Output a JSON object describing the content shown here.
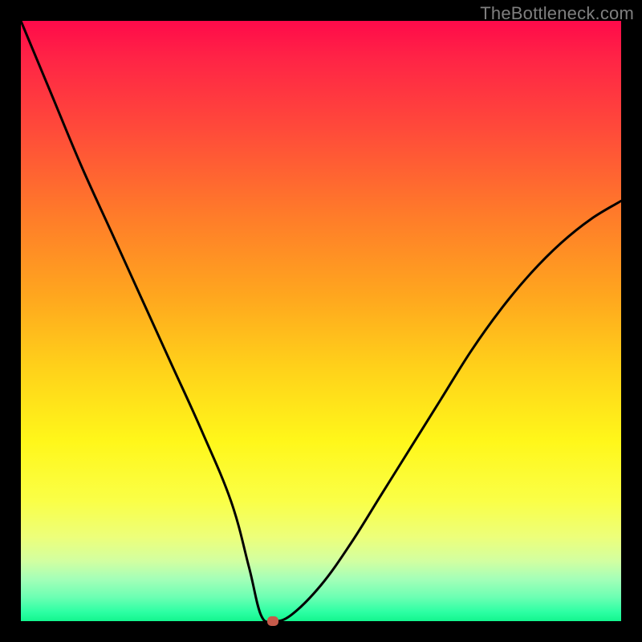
{
  "watermark": "TheBottleneck.com",
  "chart_data": {
    "type": "line",
    "title": "",
    "xlabel": "",
    "ylabel": "",
    "xlim": [
      0,
      100
    ],
    "ylim": [
      0,
      100
    ],
    "grid": false,
    "legend": false,
    "series": [
      {
        "name": "bottleneck-curve",
        "x": [
          0,
          5,
          10,
          15,
          20,
          25,
          30,
          35,
          38,
          40,
          42,
          45,
          50,
          55,
          60,
          65,
          70,
          75,
          80,
          85,
          90,
          95,
          100
        ],
        "y": [
          100,
          88,
          76,
          65,
          54,
          43,
          32,
          20,
          9,
          1,
          0,
          1,
          6,
          13,
          21,
          29,
          37,
          45,
          52,
          58,
          63,
          67,
          70
        ]
      }
    ],
    "marker": {
      "x": 42,
      "y": 0
    }
  },
  "colors": {
    "background": "#000000",
    "gradient_top": "#ff0a4a",
    "gradient_mid": "#fff71a",
    "gradient_bottom": "#13f58e",
    "curve": "#000000",
    "marker": "#c65a4a",
    "watermark": "#7f7f7f"
  }
}
